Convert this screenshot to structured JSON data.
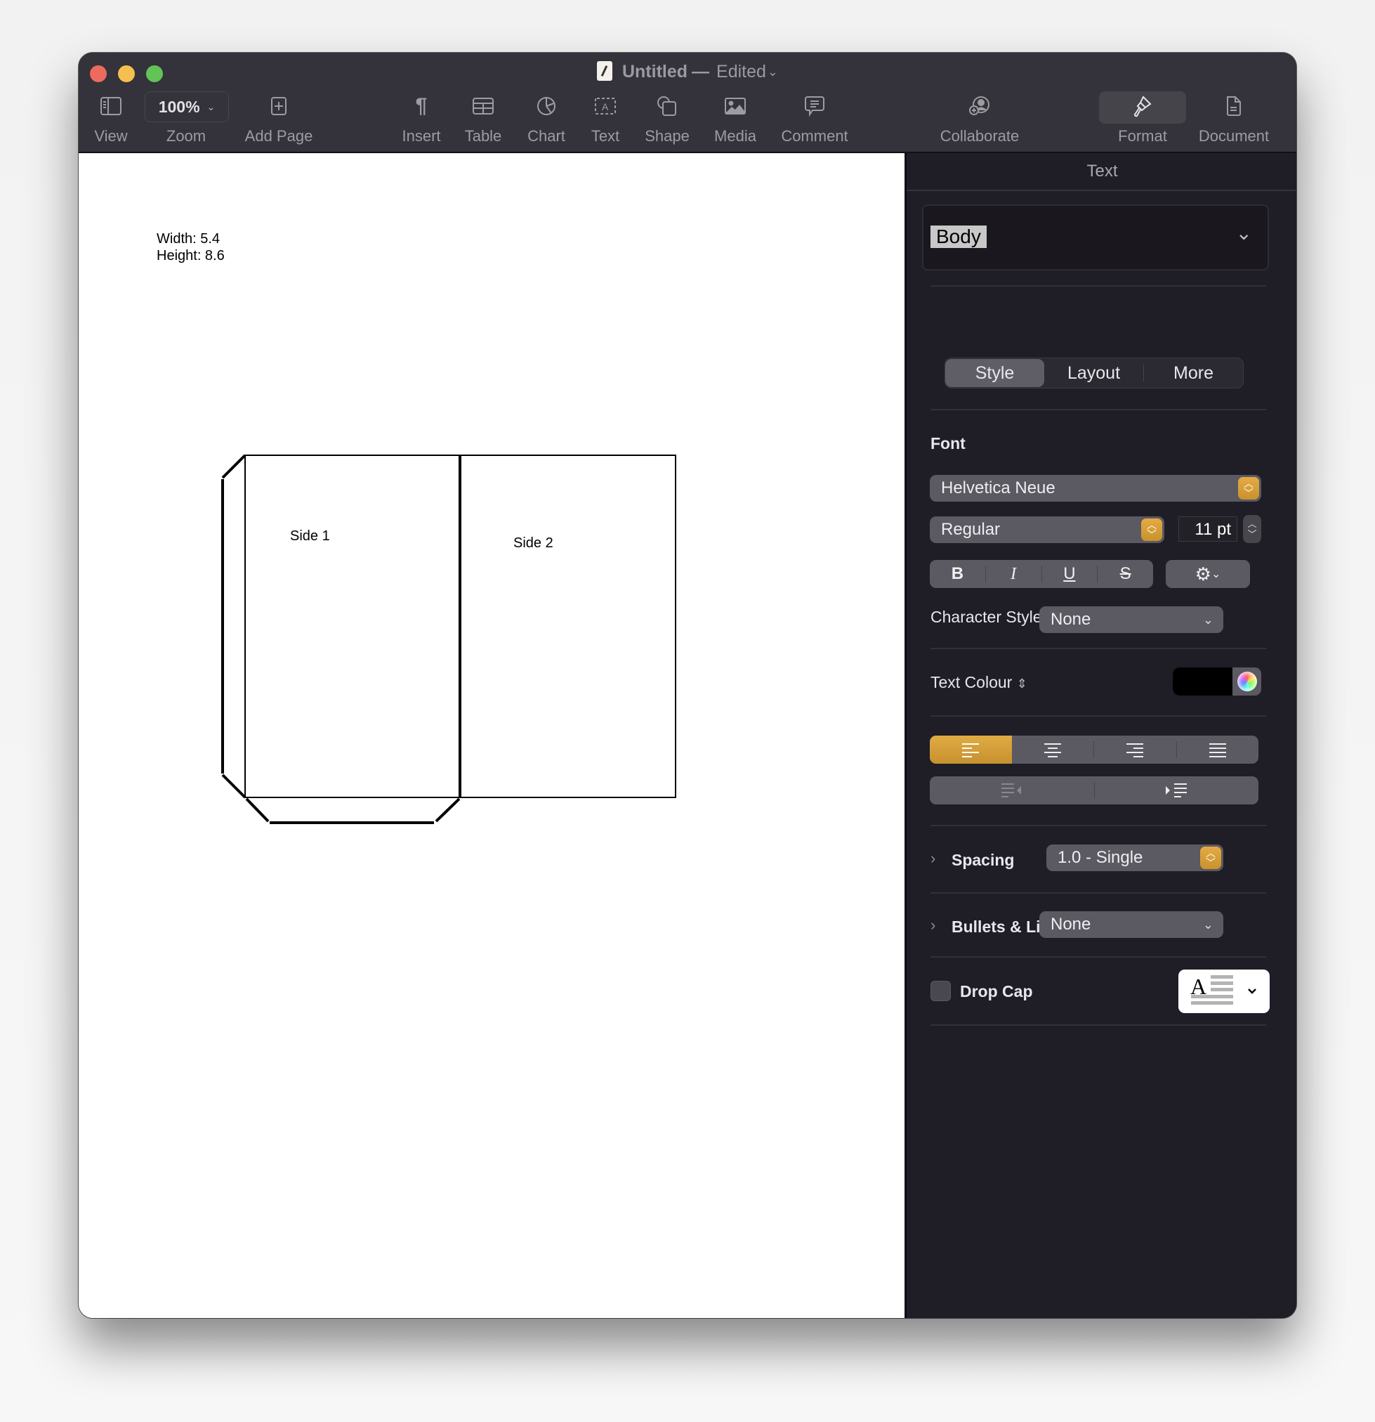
{
  "window": {
    "title": "Untitled",
    "title_separator": "—",
    "status": "Edited",
    "status_chevron": "⌄"
  },
  "toolbar": {
    "view": {
      "label": "View",
      "icon": "sidebar-icon"
    },
    "zoom": {
      "label": "Zoom",
      "value": "100%",
      "icon": "chevron-down-icon"
    },
    "add_page": {
      "label": "Add Page",
      "icon": "add-page-icon"
    },
    "insert": {
      "label": "Insert",
      "icon": "pilcrow-icon"
    },
    "table": {
      "label": "Table",
      "icon": "table-icon"
    },
    "chart": {
      "label": "Chart",
      "icon": "chart-icon"
    },
    "text": {
      "label": "Text",
      "icon": "text-box-icon"
    },
    "shape": {
      "label": "Shape",
      "icon": "shape-icon"
    },
    "media": {
      "label": "Media",
      "icon": "media-icon"
    },
    "comment": {
      "label": "Comment",
      "icon": "comment-icon"
    },
    "collaborate": {
      "label": "Collaborate",
      "icon": "collaborate-icon"
    },
    "format": {
      "label": "Format",
      "icon": "paintbrush-icon",
      "active": true
    },
    "document": {
      "label": "Document",
      "icon": "document-icon"
    }
  },
  "canvas": {
    "dims_width": "Width: 5.4",
    "dims_height": "Height: 8.6",
    "side1_label": "Side 1",
    "side2_label": "Side 2"
  },
  "sidebar": {
    "header": "Text",
    "paragraph_style": "Body",
    "tabs": [
      {
        "label": "Style",
        "active": true
      },
      {
        "label": "Layout",
        "active": false
      },
      {
        "label": "More",
        "active": false
      }
    ],
    "font": {
      "section_label": "Font",
      "family": "Helvetica Neue",
      "typeface": "Regular",
      "size": "11 pt",
      "bold": "B",
      "italic": "I",
      "underline": "U",
      "strikethrough": "S",
      "character_styles_label": "Character Styles",
      "character_styles_value": "None"
    },
    "text_colour": {
      "label": "Text Colour",
      "value": "#000000"
    },
    "alignment": {
      "options": [
        "align-left",
        "align-center",
        "align-right",
        "justify"
      ],
      "selected": "align-left",
      "accent": "#d9a23f"
    },
    "indent": {
      "options": [
        "decrease-indent",
        "increase-indent"
      ]
    },
    "spacing": {
      "label": "Spacing",
      "value": "1.0 - Single"
    },
    "bullets": {
      "label": "Bullets & Lists",
      "value": "None"
    },
    "drop_cap": {
      "label": "Drop Cap",
      "checked": false,
      "preview_letter": "A"
    }
  }
}
